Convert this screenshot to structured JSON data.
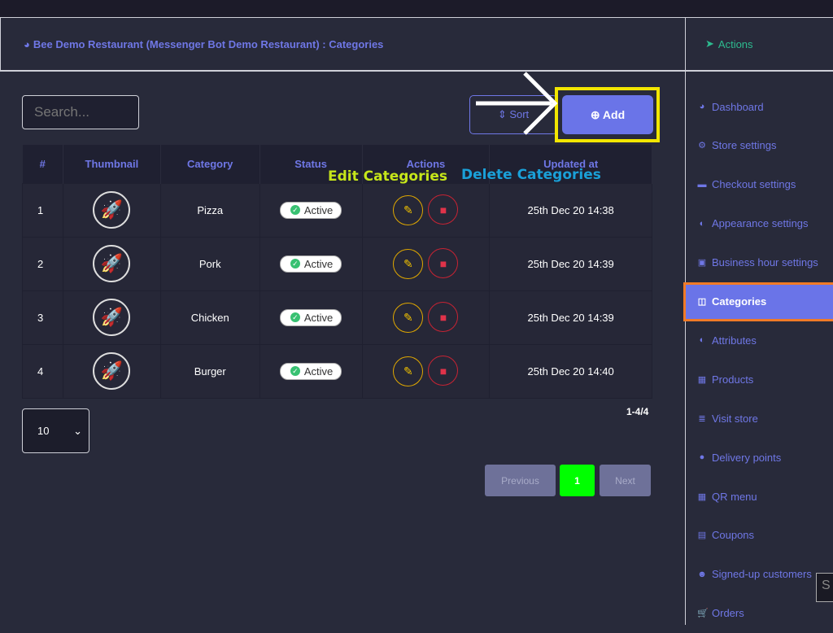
{
  "header": {
    "title": "Bee Demo Restaurant (Messenger Bot Demo Restaurant) : Categories",
    "icon": "tachometer-icon"
  },
  "side_head": {
    "title": "Actions",
    "icon": "paper-plane-icon"
  },
  "sidebar": {
    "items": [
      {
        "label": "Dashboard",
        "icon": "◕"
      },
      {
        "label": "Store settings",
        "icon": "⚙"
      },
      {
        "label": "Checkout settings",
        "icon": "▬"
      },
      {
        "label": "Appearance settings",
        "icon": "◐"
      },
      {
        "label": "Business hour settings",
        "icon": "▣"
      },
      {
        "label": "Categories",
        "icon": "◫",
        "active": true
      },
      {
        "label": "Attributes",
        "icon": "◐"
      },
      {
        "label": "Products",
        "icon": "▦"
      },
      {
        "label": "Visit store",
        "icon": "≣"
      },
      {
        "label": "Delivery points",
        "icon": "●"
      },
      {
        "label": "QR menu",
        "icon": "▦"
      },
      {
        "label": "Coupons",
        "icon": "▤"
      },
      {
        "label": "Signed-up customers",
        "icon": "☻"
      },
      {
        "label": "Orders",
        "icon": "🛒"
      }
    ]
  },
  "toolbar": {
    "search_placeholder": "Search...",
    "sort_label": "⇕ Sort",
    "add_label": "⊕ Add"
  },
  "table": {
    "columns": [
      "#",
      "Thumbnail",
      "Category",
      "Status",
      "Actions",
      "Updated at"
    ],
    "rows": [
      {
        "num": "1",
        "category": "Pizza",
        "status": "Active",
        "updated": "25th Dec 20 14:38"
      },
      {
        "num": "2",
        "category": "Pork",
        "status": "Active",
        "updated": "25th Dec 20 14:39"
      },
      {
        "num": "3",
        "category": "Chicken",
        "status": "Active",
        "updated": "25th Dec 20 14:39"
      },
      {
        "num": "4",
        "category": "Burger",
        "status": "Active",
        "updated": "25th Dec 20 14:40"
      }
    ]
  },
  "pagination": {
    "page_size": "10",
    "count": "1-4/4",
    "previous": "Previous",
    "current": "1",
    "next": "Next"
  },
  "annotations": {
    "edit": "Edit Categories",
    "delete": "Delete Categories"
  },
  "tooltip": "S",
  "colors": {
    "accent": "#6a74e8",
    "active_page": "#00ff00",
    "highlight_box": "#f2e600",
    "sidebar_highlight": "#f07a26"
  }
}
